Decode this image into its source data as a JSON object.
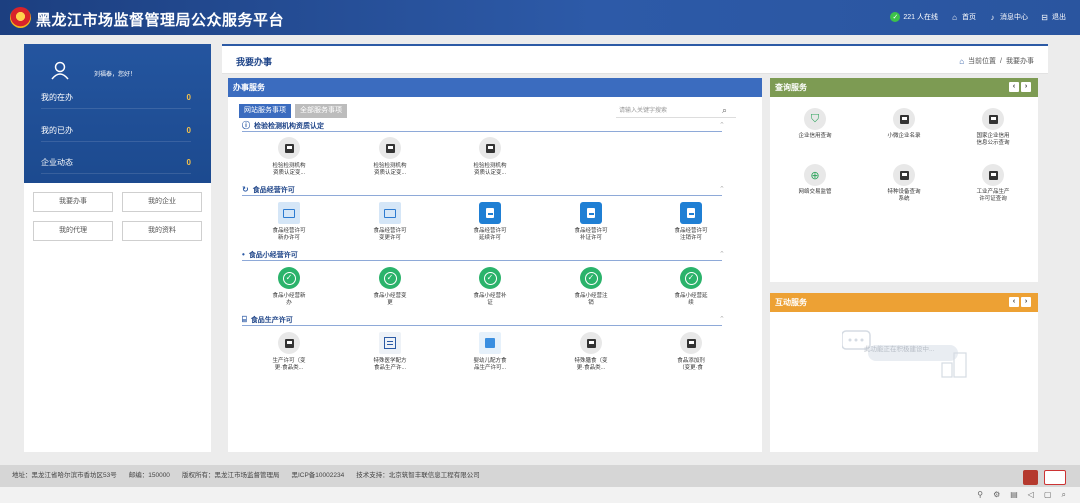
{
  "header": {
    "title": "黑龙江市场监督管理局公众服务平台",
    "online": "221 人在线",
    "home": "首页",
    "messages": "消息中心",
    "logout": "退出"
  },
  "sidebar": {
    "greeting": "刘福泰，您好！",
    "stats": [
      {
        "label": "我的在办",
        "value": "0"
      },
      {
        "label": "我的已办",
        "value": "0"
      },
      {
        "label": "企业动态",
        "value": "0"
      }
    ],
    "buttons": [
      "我要办事",
      "我的企业",
      "我的代理",
      "我的资料"
    ]
  },
  "main": {
    "title": "我要办事",
    "breadcrumb_current": "当前位置",
    "breadcrumb_sep": "/",
    "breadcrumb_page": "我要办事"
  },
  "service": {
    "title": "办事服务",
    "tabs": [
      "网站服务事项",
      "全部服务事项"
    ],
    "search_placeholder": "请输入关键字搜索",
    "sections": [
      {
        "title": "检验检测机构资质认定",
        "items": [
          [
            "检验检测机构",
            "资质认定变..."
          ],
          [
            "检验检测机构",
            "资质认定变..."
          ],
          [
            "检验检测机构",
            "资质认定变..."
          ]
        ]
      },
      {
        "title": "食品经营许可",
        "items": [
          [
            "食品经营许可",
            "新办许可"
          ],
          [
            "食品经营许可",
            "变更许可"
          ],
          [
            "食品经营许可",
            "延续许可"
          ],
          [
            "食品经营许可",
            "补证许可"
          ],
          [
            "食品经营许可",
            "注销许可"
          ]
        ]
      },
      {
        "title": "食品小经营许可",
        "items": [
          [
            "食品小经营新",
            "办"
          ],
          [
            "食品小经营变",
            "更"
          ],
          [
            "食品小经营补",
            "证"
          ],
          [
            "食品小经营注",
            "销"
          ],
          [
            "食品小经营延",
            "续"
          ]
        ]
      },
      {
        "title": "食品生产许可",
        "items": [
          [
            "生产许可（变",
            "更·食品类..."
          ],
          [
            "特殊医学配方",
            "食品生产许..."
          ],
          [
            "婴幼儿配方食",
            "品生产许可..."
          ],
          [
            "特殊膳食（变",
            "更·食品类..."
          ],
          [
            "食品添加剂",
            "（变更·食"
          ]
        ]
      }
    ]
  },
  "query": {
    "title": "查询服务",
    "items": [
      [
        "企业信用查询",
        ""
      ],
      [
        "小微企业名录",
        ""
      ],
      [
        "国家企业信用",
        "信息公示查询"
      ],
      [
        "网络交易监管",
        ""
      ],
      [
        "特种设备查询",
        "系统"
      ],
      [
        "工业产品生产",
        "许可证查询"
      ]
    ]
  },
  "interact": {
    "title": "互动服务",
    "empty_text": "此功能正在积极建设中..."
  },
  "footer": {
    "address": "地址：黑龙江省哈尔滨市香坊区53号",
    "postcode": "邮编：150000",
    "copyright": "版权所有：黑龙江市场监督管理局",
    "icp": "黑ICP备10002234",
    "support": "技术支持：北京筑智丰联信息工程有限公司"
  },
  "colors": {
    "brand": "#2c5aa5",
    "query_head": "#7d9b53",
    "interact_head": "#eda134",
    "stat_value": "#f7c34a"
  }
}
